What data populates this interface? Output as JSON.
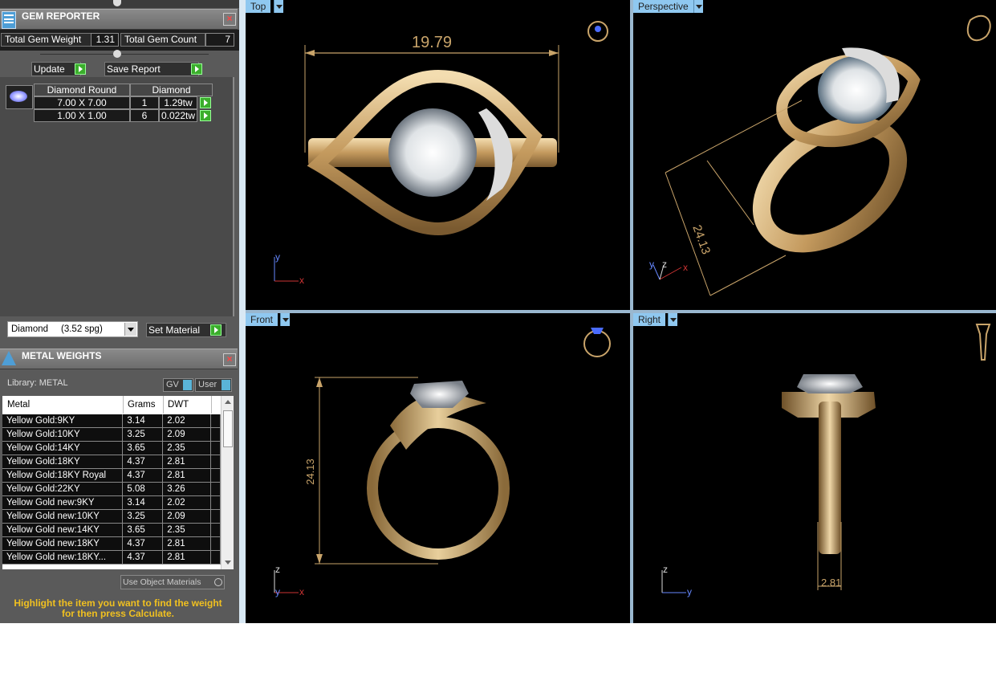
{
  "gem_reporter": {
    "title": "GEM REPORTER",
    "total_weight_label": "Total Gem Weight",
    "total_weight_value": "1.31",
    "total_count_label": "Total Gem Count",
    "total_count_value": "7",
    "update_label": "Update",
    "save_report_label": "Save Report",
    "table_headers": [
      "Diamond Round",
      "Diamond"
    ],
    "rows": [
      {
        "size": "7.00 X 7.00",
        "count": "1",
        "weight": "1.29tw"
      },
      {
        "size": "1.00 X 1.00",
        "count": "6",
        "weight": "0.022tw"
      }
    ],
    "material_select": "Diamond     (3.52 spg)",
    "set_material_label": "Set Material"
  },
  "metal_weights": {
    "title": "METAL WEIGHTS",
    "library_label": "Library: METAL",
    "gv_label": "GV",
    "user_label": "User",
    "columns": [
      "Metal",
      "Grams",
      "DWT"
    ],
    "rows": [
      {
        "metal": "Yellow Gold:9KY",
        "grams": "3.14",
        "dwt": "2.02"
      },
      {
        "metal": "Yellow Gold:10KY",
        "grams": "3.25",
        "dwt": "2.09"
      },
      {
        "metal": "Yellow Gold:14KY",
        "grams": "3.65",
        "dwt": "2.35"
      },
      {
        "metal": "Yellow Gold:18KY",
        "grams": "4.37",
        "dwt": "2.81"
      },
      {
        "metal": "Yellow Gold:18KY Royal",
        "grams": "4.37",
        "dwt": "2.81"
      },
      {
        "metal": "Yellow Gold:22KY",
        "grams": "5.08",
        "dwt": "3.26"
      },
      {
        "metal": "Yellow Gold new:9KY",
        "grams": "3.14",
        "dwt": "2.02"
      },
      {
        "metal": "Yellow Gold new:10KY",
        "grams": "3.25",
        "dwt": "2.09"
      },
      {
        "metal": "Yellow Gold new:14KY",
        "grams": "3.65",
        "dwt": "2.35"
      },
      {
        "metal": "Yellow Gold new:18KY",
        "grams": "4.37",
        "dwt": "2.81"
      },
      {
        "metal": "Yellow Gold new:18KY...",
        "grams": "4.37",
        "dwt": "2.81"
      }
    ],
    "use_object_materials": "Use Object Materials",
    "hint": "Highlight the item you want to find the weight for then press Calculate."
  },
  "viewports": {
    "top": {
      "label": "Top",
      "dimension": "19.79",
      "axis_y": "y",
      "axis_x": "x"
    },
    "perspective": {
      "label": "Perspective",
      "dimension": "24.13",
      "axis_y": "y",
      "axis_z": "z",
      "axis_x": "x"
    },
    "front": {
      "label": "Front",
      "dimension": "24.13",
      "axis_z": "z",
      "axis_y": "y",
      "axis_x": "x"
    },
    "right": {
      "label": "Right",
      "dimension": "2.81",
      "axis_z": "z",
      "axis_y": "y"
    }
  },
  "colors": {
    "gold": "#c9a46a",
    "viewport_tab": "#8fc8f0",
    "hint": "#f0c020",
    "go_button": "#3bae2c"
  }
}
